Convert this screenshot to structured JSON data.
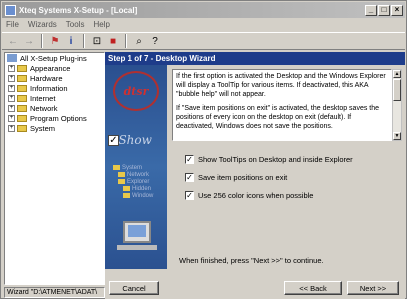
{
  "window": {
    "title": "Xteq Systems X-Setup - [Local]"
  },
  "window_buttons": [
    "_",
    "□",
    "×"
  ],
  "menu": [
    "File",
    "Wizards",
    "Tools",
    "Help"
  ],
  "tree": {
    "root": "All X-Setup Plug-ins",
    "items": [
      "Appearance",
      "Hardware",
      "Information",
      "Internet",
      "Network",
      "Program Options",
      "System"
    ]
  },
  "wizard": {
    "header": "Step 1 of 7 - Desktop Wizard",
    "info_paragraphs": [
      "If the first option is activated the Desktop and the Windows Explorer will display a ToolTip for various items. If deactivated, this AKA \"bubble help\" will not appear.",
      "If \"Save item positions on exit\" is activated, the desktop saves the positions of every icon on the desktop on exit (default). If deactivated, Windows does not save the positions."
    ],
    "options": [
      {
        "label": "Show ToolTips on Desktop and inside Explorer",
        "checked": true
      },
      {
        "label": "Save item positions on exit",
        "checked": true
      },
      {
        "label": "Use 256 color icons when possible",
        "checked": true
      }
    ],
    "finish_text": "When finished, press \"Next >>\" to continue."
  },
  "buttons": {
    "cancel": "Cancel",
    "back": "<< Back",
    "next": "Next >>"
  },
  "status": "Wizard \"D:\\ATMENET\\ADAT\\",
  "art": {
    "logo": "dtsr",
    "show": "Show",
    "tree_items": [
      "System",
      "Network",
      "Explorer",
      "Hidden",
      "Window"
    ]
  },
  "colors": {
    "header": "#1e3c8a",
    "art_bg": "#2a4f8f"
  }
}
